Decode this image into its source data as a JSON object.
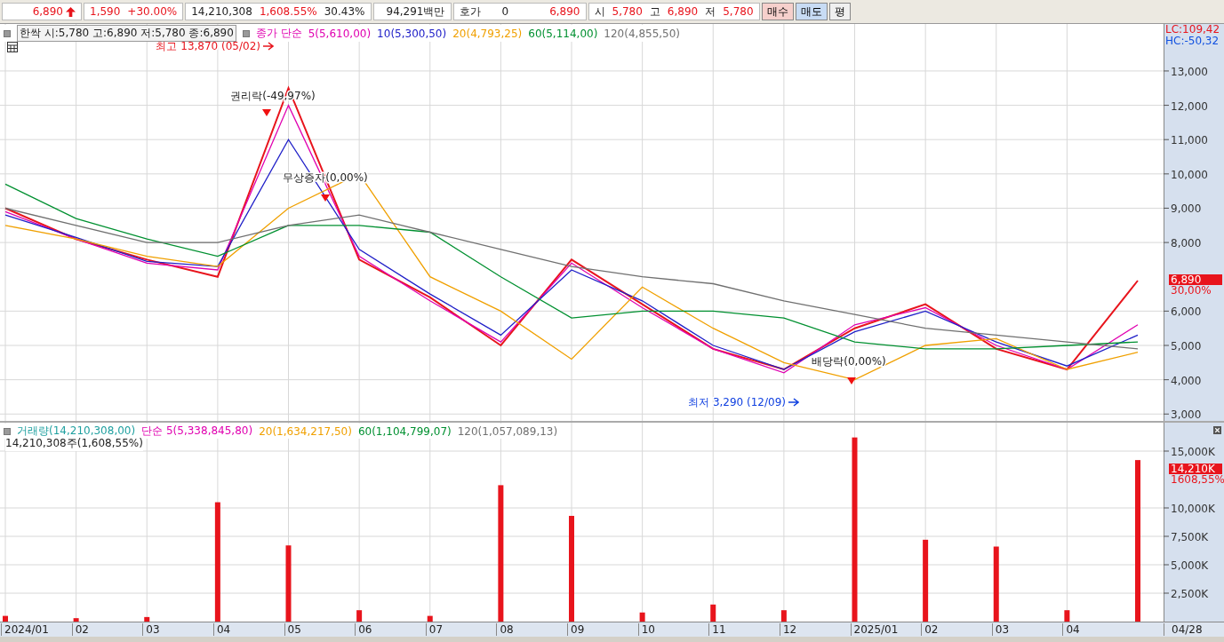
{
  "quote_bar": {
    "price": "6,890",
    "change": "1,590",
    "change_rate": "+30.00%",
    "volume": "14,210,308",
    "volume_rate": "1,608.55%",
    "turnover": "30.43%",
    "amount": "94,291백만",
    "bid_label": "호가",
    "bid_qty": "0",
    "bid_price": "6,890",
    "open_label": "시",
    "open": "5,780",
    "high_label": "고",
    "high": "6,890",
    "low_label": "저",
    "low": "5,780",
    "buttons": [
      {
        "label": "매수",
        "kind": "buy"
      },
      {
        "label": "매도",
        "kind": "sell"
      },
      {
        "label": "평",
        "kind": "plain"
      }
    ]
  },
  "price_chart": {
    "title": "한싹 시:5,780 고:6,890 저:5,780 종:6,890",
    "ma_label": "종가 단순",
    "lc": "LC:109,42",
    "hc": "HC:-50,32",
    "price_tag": "6,890",
    "change_tag": "30,00%",
    "chart_data": {
      "type": "line",
      "grid": true,
      "series": [
        {
          "color": "#e8141c",
          "values": [
            9000,
            8100,
            7500,
            7000,
            12500,
            7500,
            6400,
            5000,
            7500,
            6200,
            4900,
            4300,
            5500,
            6200,
            4900,
            4300,
            6890
          ]
        },
        {
          "name": "5(5,610,00)",
          "color": "#e000b0",
          "values": [
            8900,
            8100,
            7400,
            7200,
            12000,
            7600,
            6300,
            5100,
            7400,
            6100,
            4900,
            4200,
            5600,
            6100,
            5000,
            4300,
            5600
          ]
        },
        {
          "name": "10(5,300,50)",
          "color": "#2020c8",
          "values": [
            8800,
            8150,
            7450,
            7300,
            11000,
            7800,
            6500,
            5300,
            7200,
            6300,
            5000,
            4300,
            5400,
            6000,
            5100,
            4400,
            5300
          ]
        },
        {
          "name": "20(4,793,25)",
          "color": "#f0a000",
          "values": [
            8500,
            8100,
            7600,
            7300,
            9000,
            10000,
            7000,
            6000,
            4600,
            6700,
            5500,
            4500,
            4000,
            5000,
            5200,
            4300,
            4800
          ]
        },
        {
          "name": "60(5,114,00)",
          "color": "#009030",
          "values": [
            9700,
            8700,
            8100,
            7600,
            8500,
            8500,
            8300,
            7000,
            5800,
            6000,
            6000,
            5800,
            5100,
            4900,
            4900,
            5000,
            5100
          ]
        },
        {
          "name": "120(4,855,50)",
          "color": "#707070",
          "values": [
            9000,
            8500,
            8000,
            8000,
            8500,
            8800,
            8300,
            7800,
            7300,
            7000,
            6800,
            6300,
            5900,
            5500,
            5300,
            5100,
            4900
          ]
        }
      ],
      "ylim": [
        2800,
        14370
      ],
      "yticks": [
        {
          "value": 3000,
          "label": "3,000"
        },
        {
          "value": 4000,
          "label": "4,000"
        },
        {
          "value": 5000,
          "label": "5,000"
        },
        {
          "value": 6000,
          "label": "6,000"
        },
        {
          "value": 8000,
          "label": "8,000"
        },
        {
          "value": 9000,
          "label": "9,000"
        },
        {
          "value": 10000,
          "label": "10,000"
        },
        {
          "value": 11000,
          "label": "11,000"
        },
        {
          "value": 12000,
          "label": "12,000"
        },
        {
          "value": 13000,
          "label": "13,000"
        }
      ],
      "annotations": [
        "최고 13,870 (05/02)",
        "권리락(-49,97%)",
        "무상증자(0,00%)",
        "배당락(0,00%)",
        "최저 3,290 (12/09)"
      ]
    }
  },
  "volume_chart": {
    "legend": [
      {
        "label": "단순 5(5,338,845,80)",
        "color": "#e000b0"
      },
      {
        "label": "20(1,634,217,50)",
        "color": "#f0a000"
      },
      {
        "label": "60(1,104,799,07)",
        "color": "#009030"
      },
      {
        "label": "120(1,057,089,13)",
        "color": "#707070"
      }
    ],
    "summary": "14,210,308주(1,608,55%)",
    "volume_tag": "14,210K",
    "change_tag": "1608,55%",
    "chart_data": {
      "type": "bar",
      "grid": true,
      "categories": [
        "2024/01",
        "02",
        "03",
        "04",
        "05",
        "06",
        "07",
        "08",
        "09",
        "10",
        "11",
        "12",
        "2025/01",
        "02",
        "03",
        "04",
        "04/28"
      ],
      "series": [
        {
          "name": "거래량(14,210,308,00)",
          "color": "#e8141c",
          "values": [
            500,
            300,
            400,
            10500,
            6700,
            1000,
            500,
            12000,
            9300,
            800,
            1500,
            1000,
            16200,
            7200,
            6600,
            1000,
            14210
          ]
        }
      ],
      "ylim": [
        0,
        17500
      ],
      "yticks": [
        {
          "value": 2500,
          "label": "2,500K"
        },
        {
          "value": 5000,
          "label": "5,000K"
        },
        {
          "value": 7500,
          "label": "7,500K"
        },
        {
          "value": 10000,
          "label": "10,000K"
        },
        {
          "value": 15000,
          "label": "15,000K"
        }
      ]
    }
  }
}
